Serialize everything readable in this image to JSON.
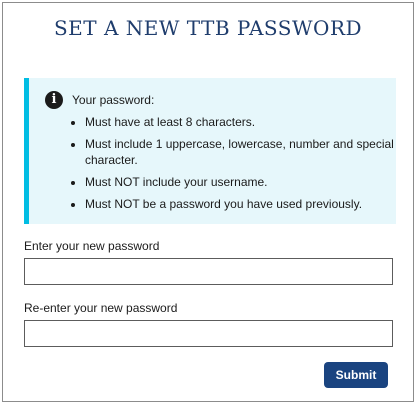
{
  "page": {
    "title": "SET A NEW TTB PASSWORD"
  },
  "info": {
    "icon": "info-circle-icon",
    "heading": "Your password:",
    "rules": [
      "Must have at least 8 characters.",
      "Must include 1 uppercase, lowercase, number and special character.",
      "Must NOT include your username.",
      "Must NOT be a password you have used previously."
    ]
  },
  "form": {
    "new_password_label": "Enter your new password",
    "new_password_value": "",
    "confirm_password_label": "Re-enter your new password",
    "confirm_password_value": "",
    "submit_label": "Submit"
  },
  "colors": {
    "title": "#1f3d6d",
    "info_background": "#e6f7fb",
    "info_border": "#00bde3",
    "button": "#1a4480"
  }
}
